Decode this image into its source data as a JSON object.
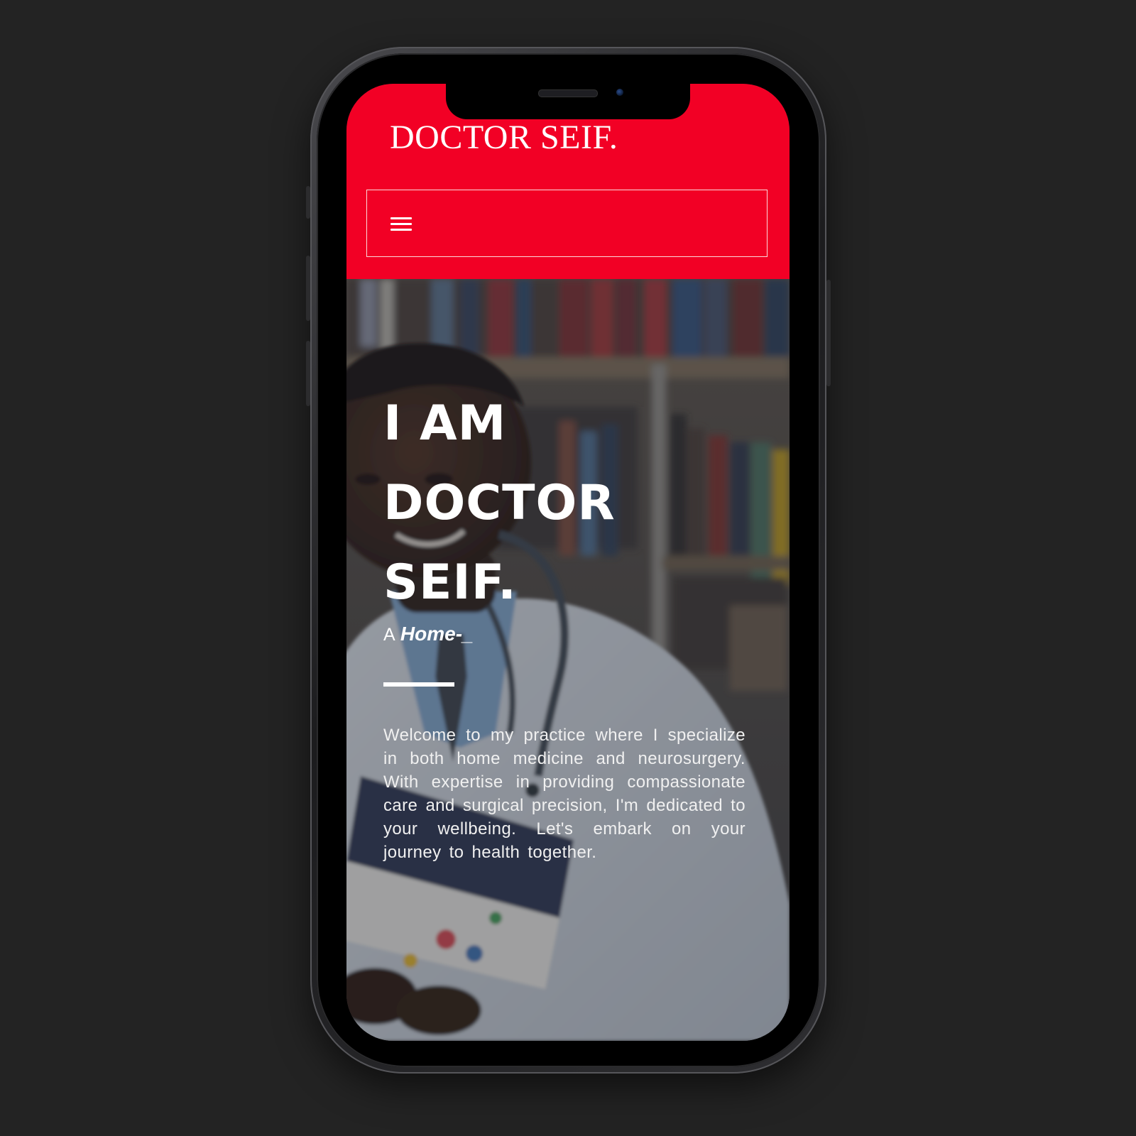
{
  "site": {
    "brand": "DOCTOR SEIF.",
    "accent_color": "#f20025",
    "background_color": "#232323"
  },
  "nav": {
    "menu_icon": "hamburger-menu-icon"
  },
  "hero": {
    "title_lines": [
      "I AM",
      "DOCTOR",
      "SEIF."
    ],
    "subtitle_prefix": "A",
    "subtitle_typed": "Home-_",
    "intro": "Welcome to my practice where I specialize in both home medicine and neurosurgery. With expertise in providing compassionate care and surgical precision, I'm dedicated to your wellbeing. Let's embark on your journey to health together."
  }
}
